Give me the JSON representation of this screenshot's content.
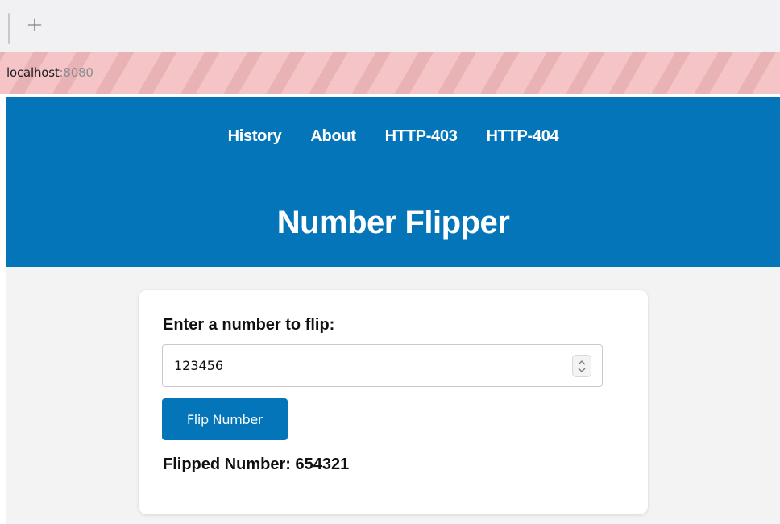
{
  "browser": {
    "new_tab_label": "+",
    "url_host": "localhost",
    "url_port": ":8080"
  },
  "nav": {
    "items": [
      {
        "label": "History"
      },
      {
        "label": "About"
      },
      {
        "label": "HTTP-403"
      },
      {
        "label": "HTTP-404"
      }
    ]
  },
  "header": {
    "title": "Number Flipper"
  },
  "form": {
    "label": "Enter a number to flip:",
    "input_value": "123456",
    "button_label": "Flip Number",
    "result_label": "Flipped Number:",
    "result_value": "654321"
  },
  "colors": {
    "primary": "#0475b9",
    "page_background": "#f3f3f3",
    "url_stripe": "#f5c4c6"
  }
}
